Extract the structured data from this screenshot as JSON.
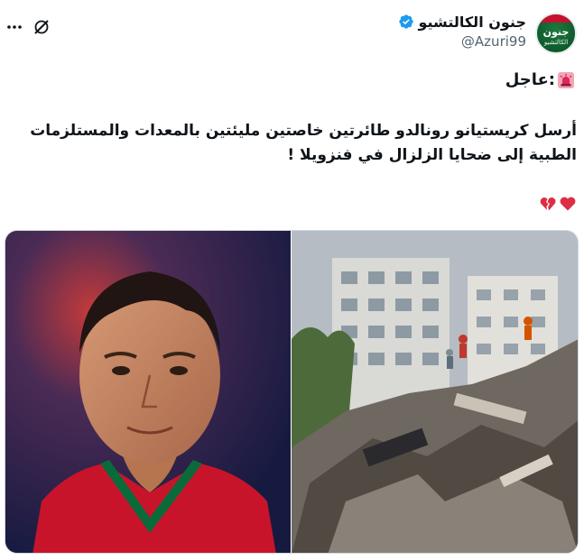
{
  "author": {
    "display_name": "جنون الكالتشيو",
    "handle": "@Azuri99",
    "verified": true,
    "avatar_text": "جنون",
    "avatar_subtext": "الكالتشيو"
  },
  "tweet": {
    "urgent_label": "عاجل:",
    "body": "أرسل كريستيانو رونالدو طائرتين خاصتين مليئتين بالمعدات والمستلزمات الطبية إلى ضحايا الزلزال في فنزويلا !",
    "emoji_icons": [
      "broken-heart-icon",
      "red-heart-icon"
    ]
  },
  "colors": {
    "verified_badge": "#1d9bf0",
    "heart_red": "#e0245e",
    "text_primary": "#0f1419",
    "text_secondary": "#536471"
  },
  "media": {
    "count": 2,
    "items": [
      "player-portrait-photo",
      "collapsed-building-photo"
    ]
  }
}
